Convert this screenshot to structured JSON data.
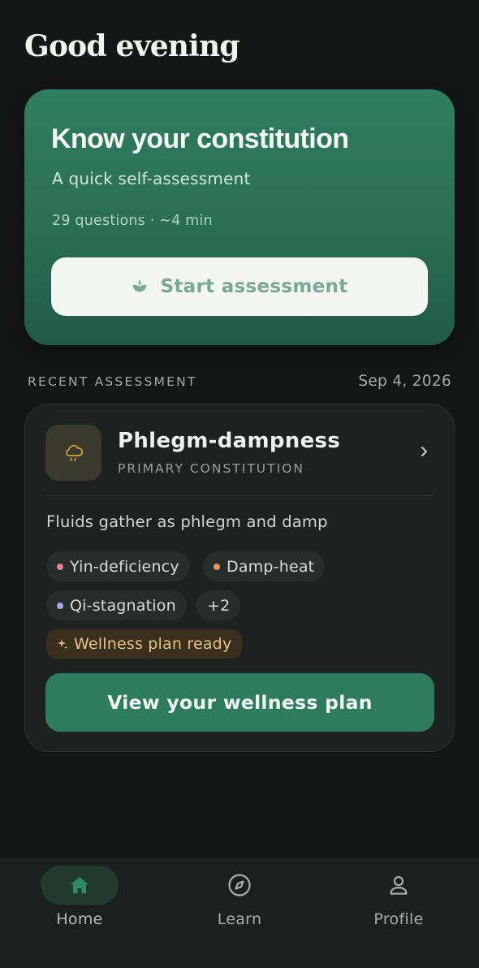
{
  "greeting": "Good evening",
  "hero": {
    "title": "Know your constitution",
    "subtitle": "A quick self-assessment",
    "meta": "29 questions · ~4 min",
    "button_label": "Start assessment",
    "button_icon": "sprout-icon"
  },
  "recent": {
    "section_label": "RECENT ASSESSMENT",
    "date": "Sep 4, 2026",
    "icon": "rain-cloud-icon",
    "title": "Phlegm-dampness",
    "subtitle": "PRIMARY CONSTITUTION",
    "description": "Fluids gather as phlegm and damp",
    "tags": [
      {
        "label": "Yin-deficiency",
        "color": "#e87e9a"
      },
      {
        "label": "Damp-heat",
        "color": "#e39a56"
      },
      {
        "label": "Qi-stagnation",
        "color": "#a8a4ec"
      },
      {
        "label": "+2"
      }
    ],
    "plan_badge": "Wellness plan ready",
    "view_button": "View your wellness plan"
  },
  "nav": {
    "items": [
      {
        "label": "Home",
        "icon": "home-icon",
        "active": true
      },
      {
        "label": "Learn",
        "icon": "compass-icon",
        "active": false
      },
      {
        "label": "Profile",
        "icon": "profile-icon",
        "active": false
      }
    ]
  },
  "colors": {
    "accent": "#2d7c60",
    "background": "#131615",
    "card": "#1d2220",
    "badge_text": "#e6c583"
  }
}
